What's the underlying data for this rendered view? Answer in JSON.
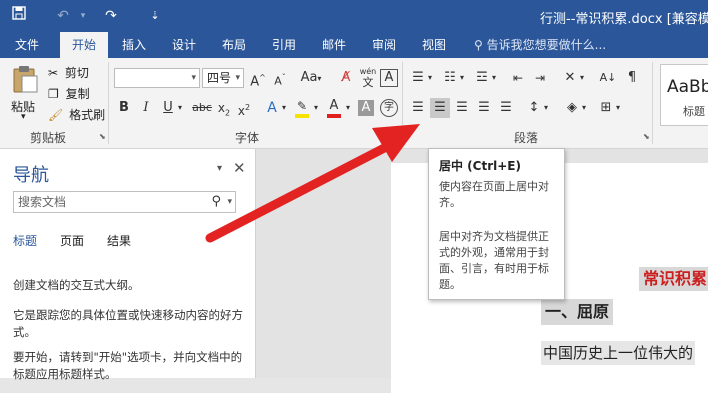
{
  "window": {
    "title": "行测--常识积累.docx [兼容模式]",
    "menu_glyph": "⇣"
  },
  "ribbon_tabs": [
    "文件",
    "开始",
    "插入",
    "设计",
    "布局",
    "引用",
    "邮件",
    "审阅",
    "视图"
  ],
  "tell_me": "告诉我您想要做什么...",
  "clipboard": {
    "paste": "粘贴",
    "cut": "剪切",
    "copy": "复制",
    "format_painter": "格式刷",
    "group_label": "剪贴板"
  },
  "font": {
    "font_name": "",
    "font_size": "四号",
    "group_label": "字体",
    "wen_glyph": "wén"
  },
  "paragraph": {
    "group_label": "段落"
  },
  "styles": {
    "sample": "AaBb",
    "label": "标题"
  },
  "tooltip": {
    "title": "居中 (Ctrl+E)",
    "line1": "使内容在页面上居中对齐。",
    "line2": "居中对齐为文档提供正式的外观，通常用于封面、引言，有时用于标题。"
  },
  "navigation": {
    "title": "导航",
    "search_placeholder": "搜索文档",
    "tabs": [
      "标题",
      "页面",
      "结果"
    ],
    "text1": "创建文档的交互式大纲。",
    "text2": "它是跟踪您的具体位置或快速移动内容的好方式。",
    "text3": "要开始，请转到\"开始\"选项卡，并向文档中的标题应用标题样式。"
  },
  "document": {
    "heading_red": "常识积累",
    "heading1": "一、屈原",
    "body_line": "中国历史上一位伟大的"
  },
  "colors": {
    "accent": "#2b579a",
    "arrow": "#e32222",
    "highlight": "#f4e400",
    "font_red": "#e02020"
  }
}
